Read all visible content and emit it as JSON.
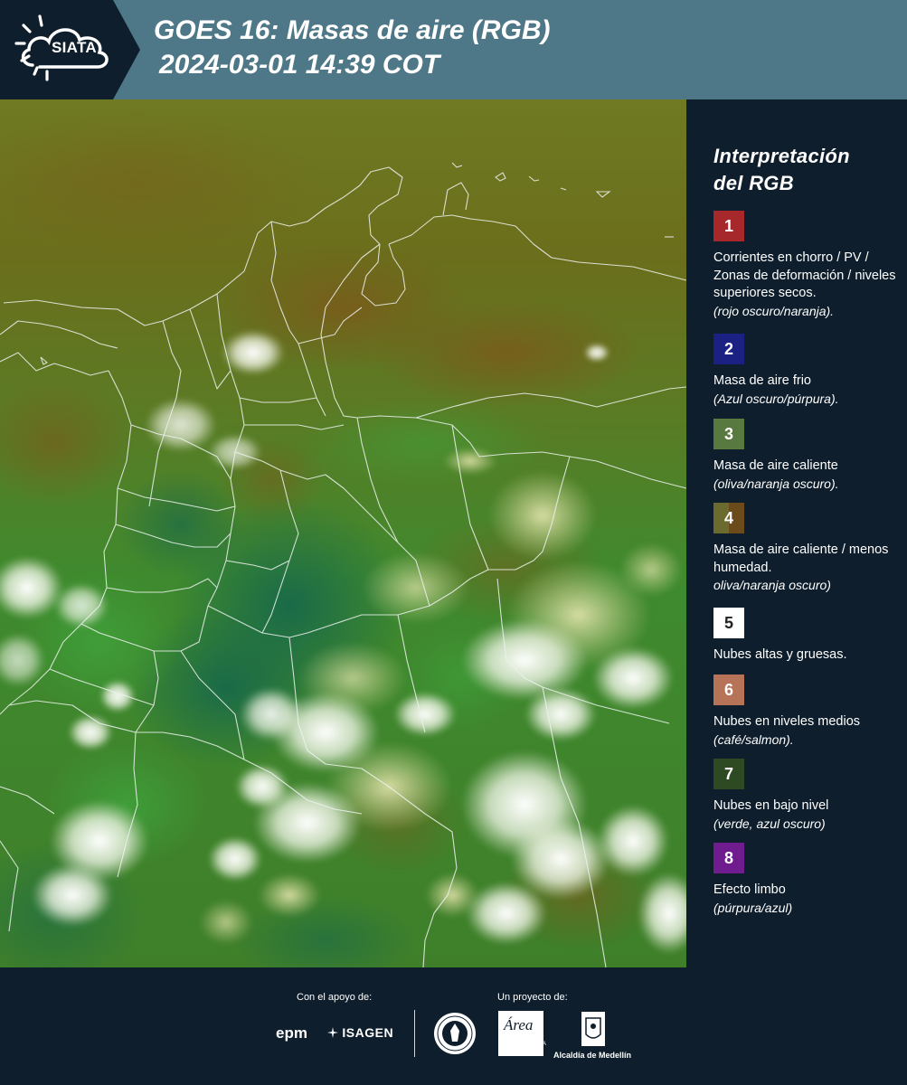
{
  "header": {
    "logo_text": "SIATA",
    "title_line1": "GOES 16: Masas de aire (RGB)",
    "title_line2": "2024-03-01 14:39 COT",
    "background_color": "#4e7787"
  },
  "legend": {
    "title_line1": "Interpretación",
    "title_line2": "del RGB",
    "items": [
      {
        "number": "1",
        "color": "#a7282b",
        "desc": "Corrientes en chorro / PV / Zonas de deformación / niveles superiores secos.",
        "note": "(rojo oscuro/naranja)."
      },
      {
        "number": "2",
        "color": "#1b2183",
        "desc": "Masa de aire frio",
        "note": "(Azul oscuro/púrpura)."
      },
      {
        "number": "3",
        "color": "#587a41",
        "desc": "Masa de aire caliente",
        "note": "(oliva/naranja oscuro)."
      },
      {
        "number": "4",
        "color": "#6b5a2a",
        "desc": "Masa de aire caliente / menos humedad.",
        "note": "oliva/naranja oscuro)"
      },
      {
        "number": "5",
        "color": "#ffffff",
        "desc": "Nubes altas y gruesas.",
        "note": ""
      },
      {
        "number": "6",
        "color": "#b67357",
        "desc": "Nubes en niveles medios",
        "note": "(café/salmon)."
      },
      {
        "number": "7",
        "color": "#2e4a22",
        "desc": "Nubes en bajo nivel",
        "note": "(verde, azul oscuro)"
      },
      {
        "number": "8",
        "color": "#6f1d8e",
        "desc": "Efecto limbo",
        "note": "(púrpura/azul)"
      }
    ]
  },
  "footer": {
    "support_label": "Con el apoyo de:",
    "project_label": "Un proyecto de:",
    "sponsors": [
      "epm",
      "ISAGEN"
    ],
    "partners": [
      "Área Metropolitana Valle de Aburrá",
      "Alcaldía de Medellín"
    ],
    "area_logo_text": "Área",
    "area_caption": "METROPOLITANA Valle de Aburrá",
    "alcaldia_caption": "Alcaldía de Medellín"
  }
}
